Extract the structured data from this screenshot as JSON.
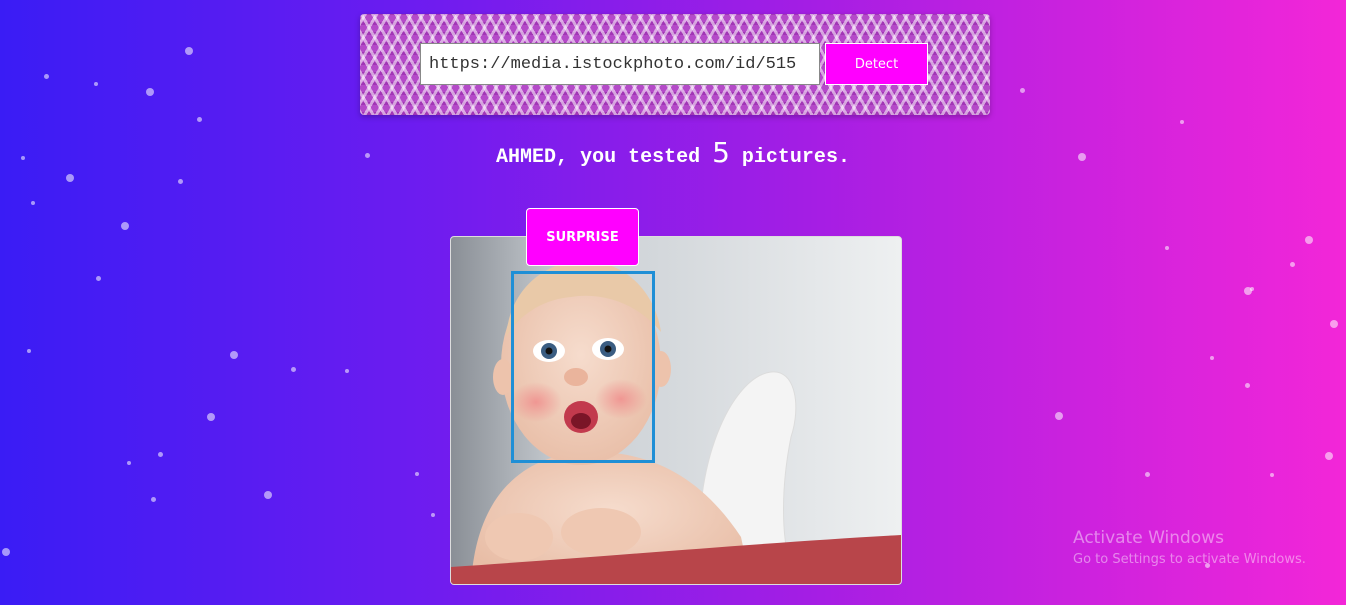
{
  "search": {
    "url_value": "https://media.istockphoto.com/id/515",
    "detect_label": "Detect"
  },
  "summary": {
    "user": "AHMED",
    "prefix": ", you tested ",
    "count": "5",
    "suffix": " pictures."
  },
  "result": {
    "emotion": "SURPRISE"
  },
  "watermark": {
    "title": "Activate Windows",
    "subtitle": "Go to Settings to activate Windows."
  },
  "colors": {
    "accent": "#ff00ff",
    "face_box": "#1f8fd6",
    "bg_left": "#3a1cf5",
    "bg_right": "#f326d8"
  }
}
